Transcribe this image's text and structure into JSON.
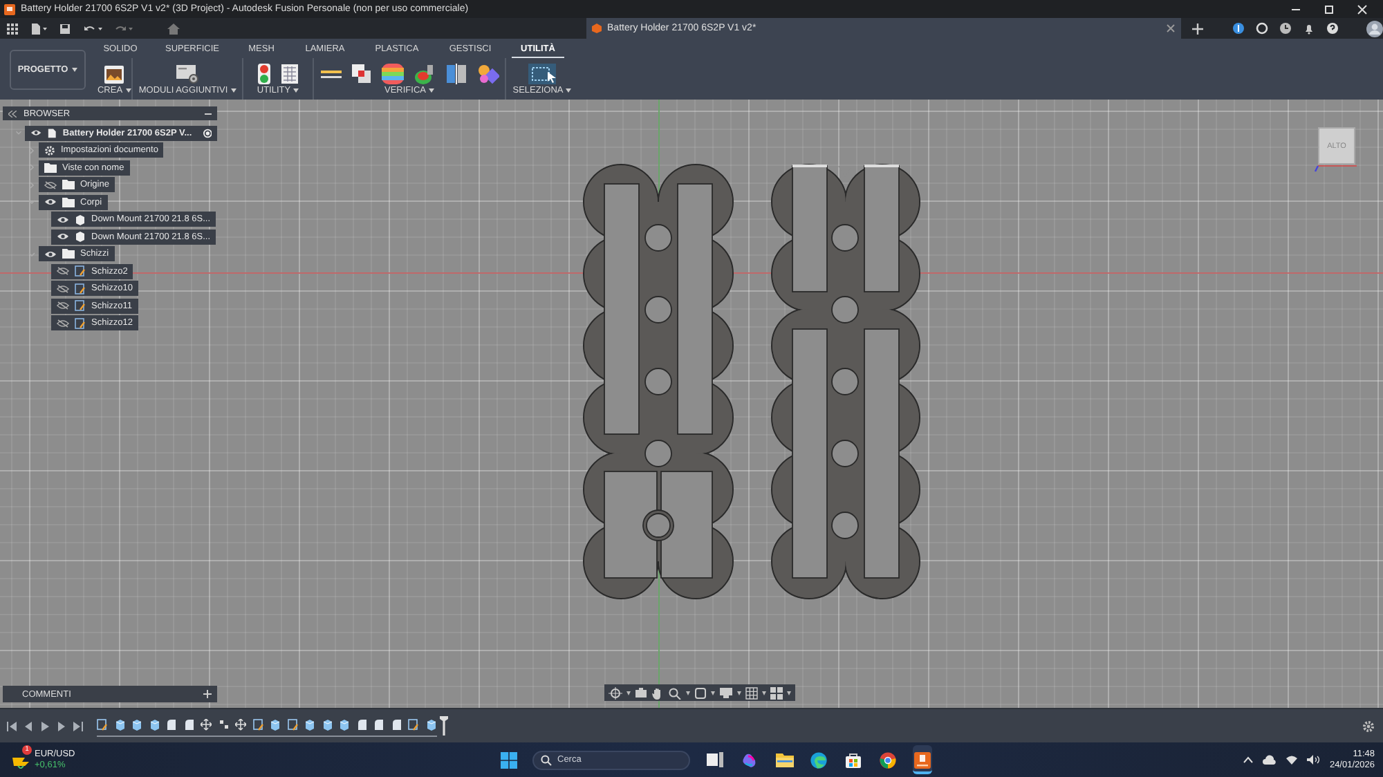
{
  "window": {
    "title": "Battery Holder 21700 6S2P V1 v2* (3D Project) - Autodesk Fusion Personale (non per uso commerciale)"
  },
  "document_tab": {
    "title": "Battery Holder 21700 6S2P V1 v2*"
  },
  "ribbon": {
    "workspace": "PROGETTO",
    "tabs": [
      {
        "label": "SOLIDO",
        "selected": false
      },
      {
        "label": "SUPERFICIE",
        "selected": false
      },
      {
        "label": "MESH",
        "selected": false
      },
      {
        "label": "LAMIERA",
        "selected": false
      },
      {
        "label": "PLASTICA",
        "selected": false
      },
      {
        "label": "GESTISCI",
        "selected": false
      },
      {
        "label": "UTILITÀ",
        "selected": true
      }
    ],
    "groups": [
      {
        "label": "CREA"
      },
      {
        "label": "MODULI AGGIUNTIVI"
      },
      {
        "label": "UTILITY"
      },
      {
        "label": "VERIFICA"
      },
      {
        "label": "SELEZIONA"
      }
    ]
  },
  "browser": {
    "title": "BROWSER",
    "tree": [
      {
        "label": "Battery Holder 21700 6S2P V...",
        "kind": "document",
        "visible": true,
        "expanded": true,
        "children": [
          {
            "label": "Impostazioni documento",
            "kind": "settings",
            "expanded": false
          },
          {
            "label": "Viste con nome",
            "kind": "folder",
            "expanded": false
          },
          {
            "label": "Origine",
            "kind": "folder",
            "visible": false,
            "expanded": false
          },
          {
            "label": "Corpi",
            "kind": "folder",
            "visible": true,
            "expanded": true,
            "children": [
              {
                "label": "Down Mount 21700 21.8 6S...",
                "kind": "body",
                "visible": true
              },
              {
                "label": "Down Mount 21700 21.8 6S...",
                "kind": "body",
                "visible": true
              }
            ]
          },
          {
            "label": "Schizzi",
            "kind": "folder",
            "visible": true,
            "expanded": true,
            "children": [
              {
                "label": "Schizzo2",
                "kind": "sketch",
                "visible": false
              },
              {
                "label": "Schizzo10",
                "kind": "sketch",
                "visible": false
              },
              {
                "label": "Schizzo11",
                "kind": "sketch",
                "visible": false
              },
              {
                "label": "Schizzo12",
                "kind": "sketch",
                "visible": false
              }
            ]
          }
        ]
      }
    ]
  },
  "viewcube": {
    "face": "ALTO"
  },
  "comments": {
    "title": "COMMENTI"
  },
  "taskbar": {
    "widget": {
      "label": "EUR/USD",
      "change": "+0,61%",
      "badge": "1"
    },
    "search": {
      "placeholder": "Cerca"
    },
    "apps": [
      {
        "kind": "taskview",
        "selected": false
      },
      {
        "kind": "copilot",
        "selected": false
      },
      {
        "kind": "explorer",
        "selected": false
      },
      {
        "kind": "edge",
        "selected": false
      },
      {
        "kind": "store",
        "selected": false
      },
      {
        "kind": "chrome",
        "selected": false
      },
      {
        "kind": "fusion",
        "selected": true
      }
    ],
    "clock": {
      "time": "11:48",
      "date": "24/01/2026"
    }
  }
}
